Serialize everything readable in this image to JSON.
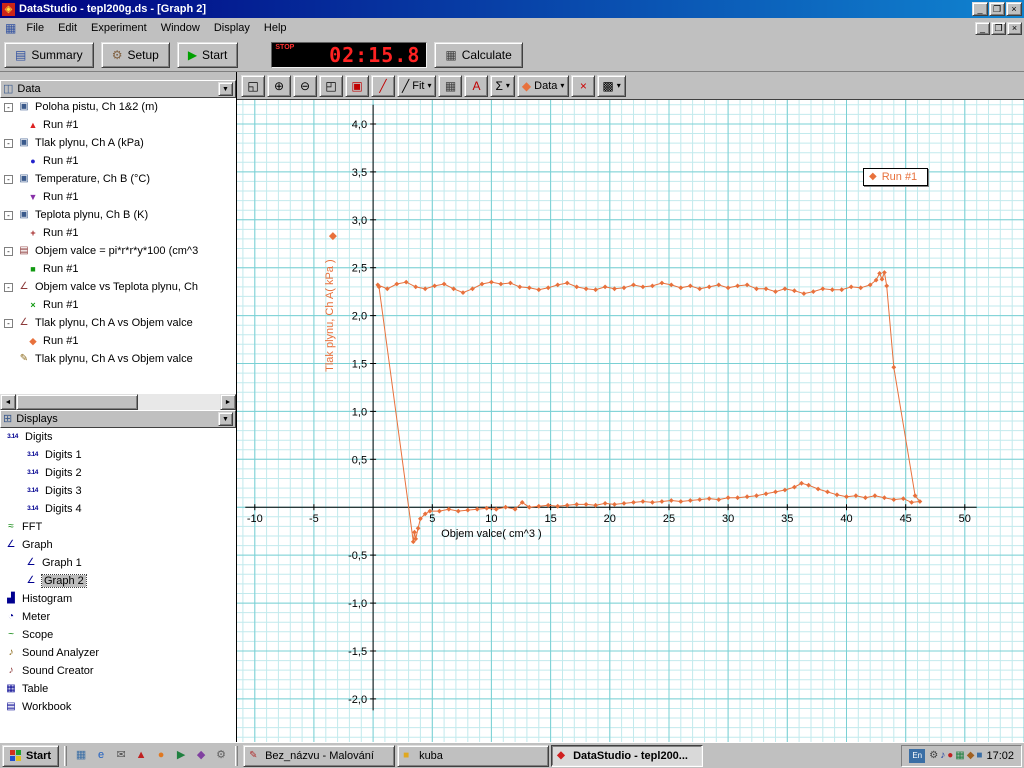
{
  "titlebar": {
    "title": "DataStudio - tepl200g.ds - [Graph 2]"
  },
  "menubar": {
    "items": [
      "File",
      "Edit",
      "Experiment",
      "Window",
      "Display",
      "Help"
    ]
  },
  "main_toolbar": {
    "summary_label": "Summary",
    "setup_label": "Setup",
    "start_label": "Start",
    "timer": {
      "stop_label": "STOP",
      "value": "02:15.8",
      "color": "#ff2222"
    },
    "calculate_label": "Calculate"
  },
  "graph_toolbar": {
    "buttons": [
      {
        "name": "scale-to-fit-button",
        "glyph": "◱",
        "color": "#000000"
      },
      {
        "name": "zoom-in-button",
        "glyph": "⊕",
        "color": "#000000"
      },
      {
        "name": "zoom-out-button",
        "glyph": "⊖",
        "color": "#000000"
      },
      {
        "name": "zoom-select-button",
        "glyph": "◰",
        "color": "#000000"
      },
      {
        "name": "smart-tool-button",
        "glyph": "▣",
        "color": "#c00000"
      },
      {
        "name": "slope-tool-button",
        "glyph": "╱",
        "color": "#c00000"
      },
      {
        "name": "fit-menu-button",
        "glyph": "╱",
        "label": "Fit",
        "dropdown": true,
        "color": "#000000"
      },
      {
        "name": "calculator-button",
        "glyph": "▦",
        "color": "#404040"
      },
      {
        "name": "text-annotation-button",
        "glyph": "A",
        "color": "#c00000"
      },
      {
        "name": "statistics-menu-button",
        "glyph": "Σ",
        "dropdown": true,
        "color": "#000000"
      },
      {
        "name": "data-menu-button",
        "glyph": "◆",
        "label": "Data",
        "dropdown": true,
        "color": "#e8713c"
      },
      {
        "name": "delete-button",
        "glyph": "×",
        "color": "#cc0000"
      },
      {
        "name": "graph-settings-button",
        "glyph": "▩",
        "dropdown": true,
        "color": "#000000"
      }
    ]
  },
  "sidebar": {
    "data_panel": {
      "header": "Data",
      "items": [
        {
          "label": "Poloha pistu, Ch 1&2 (m)",
          "icon": "sensor-icon",
          "runs": [
            {
              "label": "Run #1",
              "marker": "▲",
              "color": "#dd2222"
            }
          ]
        },
        {
          "label": "Tlak plynu, Ch A (kPa)",
          "icon": "sensor-icon",
          "runs": [
            {
              "label": "Run #1",
              "marker": "●",
              "color": "#2222cc"
            }
          ]
        },
        {
          "label": "Temperature, Ch B (°C)",
          "icon": "sensor-icon",
          "runs": [
            {
              "label": "Run #1",
              "marker": "▼",
              "color": "#8830a8"
            }
          ]
        },
        {
          "label": "Teplota plynu, Ch B (K)",
          "icon": "sensor-icon",
          "runs": [
            {
              "label": "Run #1",
              "marker": "+",
              "color": "#a02020"
            }
          ]
        },
        {
          "label": "Objem valce = pi*r*r*y*100 (cm^3",
          "icon": "calc-icon",
          "runs": [
            {
              "label": "Run #1",
              "marker": "■",
              "color": "#119911"
            }
          ]
        },
        {
          "label": "Objem valce vs Teplota plynu, Ch",
          "icon": "xy-data-icon",
          "runs": [
            {
              "label": "Run #1",
              "marker": "×",
              "color": "#119911"
            }
          ]
        },
        {
          "label": "Tlak plynu, Ch A vs Objem valce",
          "icon": "xy-data-icon",
          "runs": [
            {
              "label": "Run #1",
              "marker": "◆",
              "color": "#e8713c"
            }
          ]
        },
        {
          "label": "Tlak plynu, Ch A vs Objem valce",
          "icon": "pencil-icon",
          "no_box": true,
          "runs": []
        }
      ]
    },
    "displays_panel": {
      "header": "Displays",
      "items": [
        {
          "label": "Digits",
          "icon": "digits-icon",
          "children": [
            {
              "label": "Digits 1",
              "icon": "digits-icon"
            },
            {
              "label": "Digits 2",
              "icon": "digits-icon"
            },
            {
              "label": "Digits 3",
              "icon": "digits-icon"
            },
            {
              "label": "Digits 4",
              "icon": "digits-icon"
            }
          ]
        },
        {
          "label": "FFT",
          "icon": "fft-icon"
        },
        {
          "label": "Graph",
          "icon": "graph-icon",
          "children": [
            {
              "label": "Graph 1",
              "icon": "graph-icon"
            },
            {
              "label": "Graph 2",
              "icon": "graph-icon",
              "selected": true
            }
          ]
        },
        {
          "label": "Histogram",
          "icon": "histogram-icon"
        },
        {
          "label": "Meter",
          "icon": "meter-icon"
        },
        {
          "label": "Scope",
          "icon": "scope-icon"
        },
        {
          "label": "Sound Analyzer",
          "icon": "sound-analyzer-icon"
        },
        {
          "label": "Sound Creator",
          "icon": "sound-creator-icon"
        },
        {
          "label": "Table",
          "icon": "table-icon"
        },
        {
          "label": "Workbook",
          "icon": "workbook-icon"
        }
      ]
    }
  },
  "taskbar": {
    "start_label": "Start",
    "quicklaunch": [
      {
        "name": "quicklaunch-icon-1",
        "glyph": "▦",
        "color": "#3a6ea5"
      },
      {
        "name": "quicklaunch-icon-2",
        "glyph": "e",
        "color": "#2060c0"
      },
      {
        "name": "quicklaunch-icon-3",
        "glyph": "✉",
        "color": "#505050"
      },
      {
        "name": "quicklaunch-icon-4",
        "glyph": "▲",
        "color": "#c02020"
      },
      {
        "name": "quicklaunch-icon-5",
        "glyph": "●",
        "color": "#e07820"
      },
      {
        "name": "quicklaunch-icon-6",
        "glyph": "▶",
        "color": "#208040"
      },
      {
        "name": "quicklaunch-icon-7",
        "glyph": "◆",
        "color": "#8040a0"
      },
      {
        "name": "quicklaunch-icon-8",
        "glyph": "⚙",
        "color": "#606060"
      }
    ],
    "tasks": [
      {
        "label": "Bez_názvu - Malování",
        "icon_glyph": "✎",
        "icon_color": "#b03030",
        "active": false
      },
      {
        "label": "kuba",
        "icon_glyph": "■",
        "icon_color": "#e0a820",
        "active": false
      },
      {
        "label": "DataStudio - tepl200...",
        "icon_glyph": "◆",
        "icon_color": "#d02020",
        "active": true
      }
    ],
    "tray_lang": "En",
    "tray_icons": [
      {
        "name": "tray-icon-1",
        "glyph": "⚙",
        "color": "#404040"
      },
      {
        "name": "tray-icon-2",
        "glyph": "♪",
        "color": "#2040a0"
      },
      {
        "name": "tray-icon-3",
        "glyph": "●",
        "color": "#c02020"
      },
      {
        "name": "tray-icon-4",
        "glyph": "▦",
        "color": "#208040"
      },
      {
        "name": "tray-icon-5",
        "glyph": "◆",
        "color": "#a06020"
      },
      {
        "name": "tray-icon-6",
        "glyph": "■",
        "color": "#3a6ea5"
      }
    ],
    "tray_time": "17:02"
  },
  "chart_data": {
    "type": "scatter",
    "title": "",
    "xlabel": "Objem valce( cm^3 )",
    "ylabel": "Tlak plynu, Ch A( kPa )",
    "xlim": [
      -11.5,
      55
    ],
    "ylim": [
      -2.45,
      4.25
    ],
    "x_ticks": [
      -10,
      -5,
      5,
      10,
      15,
      20,
      25,
      30,
      35,
      40,
      45,
      50
    ],
    "x_tick_labels": [
      "-10",
      "-5",
      "5",
      "10",
      "15",
      "20",
      "25",
      "30",
      "35",
      "40",
      "45",
      "50"
    ],
    "y_ticks": [
      4,
      3.5,
      3,
      2.5,
      2,
      1.5,
      1,
      0.5,
      -0.5,
      -1,
      -1.5,
      -2
    ],
    "y_tick_labels": [
      "4,0",
      "3,5",
      "3,0",
      "2,5",
      "2,0",
      "1,5",
      "1,0",
      "0,5",
      "-0,5",
      "-1,0",
      "-1,5",
      "-2,0"
    ],
    "grid": {
      "minor_step_x": 1,
      "minor_step_y": 0.1,
      "major_step_x": 5,
      "major_step_y": 0.5,
      "minor_color": "#c2eaed",
      "major_color": "#7ad0d4"
    },
    "axis_color": "#000000",
    "legend_label": "Run #1",
    "marker_glyph": "◆",
    "series": [
      {
        "name": "Run #1",
        "color": "#e8713c",
        "marker": "diamond",
        "points": [
          [
            0.4,
            2.32
          ],
          [
            1.2,
            2.28
          ],
          [
            2,
            2.33
          ],
          [
            2.8,
            2.35
          ],
          [
            3.6,
            2.3
          ],
          [
            4.4,
            2.28
          ],
          [
            5.2,
            2.31
          ],
          [
            6,
            2.33
          ],
          [
            6.8,
            2.28
          ],
          [
            7.6,
            2.24
          ],
          [
            8.4,
            2.28
          ],
          [
            9.2,
            2.33
          ],
          [
            10,
            2.35
          ],
          [
            10.8,
            2.33
          ],
          [
            11.6,
            2.34
          ],
          [
            12.4,
            2.3
          ],
          [
            13.2,
            2.29
          ],
          [
            14,
            2.27
          ],
          [
            14.8,
            2.29
          ],
          [
            15.6,
            2.32
          ],
          [
            16.4,
            2.34
          ],
          [
            17.2,
            2.3
          ],
          [
            18,
            2.28
          ],
          [
            18.8,
            2.27
          ],
          [
            19.6,
            2.3
          ],
          [
            20.4,
            2.28
          ],
          [
            21.2,
            2.29
          ],
          [
            22,
            2.32
          ],
          [
            22.8,
            2.3
          ],
          [
            23.6,
            2.31
          ],
          [
            24.4,
            2.34
          ],
          [
            25.2,
            2.32
          ],
          [
            26,
            2.29
          ],
          [
            26.8,
            2.31
          ],
          [
            27.6,
            2.28
          ],
          [
            28.4,
            2.3
          ],
          [
            29.2,
            2.32
          ],
          [
            30,
            2.29
          ],
          [
            30.8,
            2.31
          ],
          [
            31.6,
            2.32
          ],
          [
            32.4,
            2.28
          ],
          [
            33.2,
            2.28
          ],
          [
            34,
            2.25
          ],
          [
            34.8,
            2.28
          ],
          [
            35.6,
            2.26
          ],
          [
            36.4,
            2.23
          ],
          [
            37.2,
            2.25
          ],
          [
            38,
            2.28
          ],
          [
            38.8,
            2.27
          ],
          [
            39.6,
            2.27
          ],
          [
            40.4,
            2.3
          ],
          [
            41.2,
            2.29
          ],
          [
            42,
            2.32
          ],
          [
            42.5,
            2.37
          ],
          [
            42.8,
            2.44
          ],
          [
            43,
            2.38
          ],
          [
            43.2,
            2.45
          ],
          [
            43.4,
            2.31
          ],
          [
            44,
            1.46
          ],
          [
            45.8,
            0.12
          ],
          [
            46.2,
            0.06
          ],
          [
            45.5,
            0.05
          ],
          [
            44.8,
            0.09
          ],
          [
            44,
            0.08
          ],
          [
            43.2,
            0.1
          ],
          [
            42.4,
            0.12
          ],
          [
            41.6,
            0.1
          ],
          [
            40.8,
            0.12
          ],
          [
            40,
            0.11
          ],
          [
            39.2,
            0.13
          ],
          [
            38.4,
            0.16
          ],
          [
            37.6,
            0.19
          ],
          [
            36.8,
            0.23
          ],
          [
            36.2,
            0.25
          ],
          [
            35.6,
            0.21
          ],
          [
            34.8,
            0.18
          ],
          [
            34,
            0.16
          ],
          [
            33.2,
            0.14
          ],
          [
            32.4,
            0.12
          ],
          [
            31.6,
            0.11
          ],
          [
            30.8,
            0.1
          ],
          [
            30,
            0.1
          ],
          [
            29.2,
            0.08
          ],
          [
            28.4,
            0.09
          ],
          [
            27.6,
            0.08
          ],
          [
            26.8,
            0.07
          ],
          [
            26,
            0.06
          ],
          [
            25.2,
            0.07
          ],
          [
            24.4,
            0.06
          ],
          [
            23.6,
            0.05
          ],
          [
            22.8,
            0.06
          ],
          [
            22,
            0.05
          ],
          [
            21.2,
            0.04
          ],
          [
            20.4,
            0.03
          ],
          [
            19.6,
            0.04
          ],
          [
            18.8,
            0.02
          ],
          [
            18,
            0.03
          ],
          [
            17.2,
            0.03
          ],
          [
            16.4,
            0.02
          ],
          [
            15.6,
            0.01
          ],
          [
            14.8,
            0.02
          ],
          [
            14,
            0.01
          ],
          [
            13.2,
            0
          ],
          [
            12.6,
            0.05
          ],
          [
            12,
            -0.02
          ],
          [
            11.2,
            0
          ],
          [
            10.4,
            -0.02
          ],
          [
            9.6,
            -0.01
          ],
          [
            8.8,
            -0.02
          ],
          [
            8,
            -0.03
          ],
          [
            7.2,
            -0.04
          ],
          [
            6.4,
            -0.02
          ],
          [
            5.6,
            -0.04
          ],
          [
            4.8,
            -0.04
          ],
          [
            4.4,
            -0.07
          ],
          [
            4,
            -0.12
          ],
          [
            3.8,
            -0.22
          ],
          [
            3.6,
            -0.33
          ],
          [
            3.5,
            -0.26
          ],
          [
            3.4,
            -0.36
          ],
          [
            0.5,
            2.3
          ]
        ]
      }
    ]
  }
}
